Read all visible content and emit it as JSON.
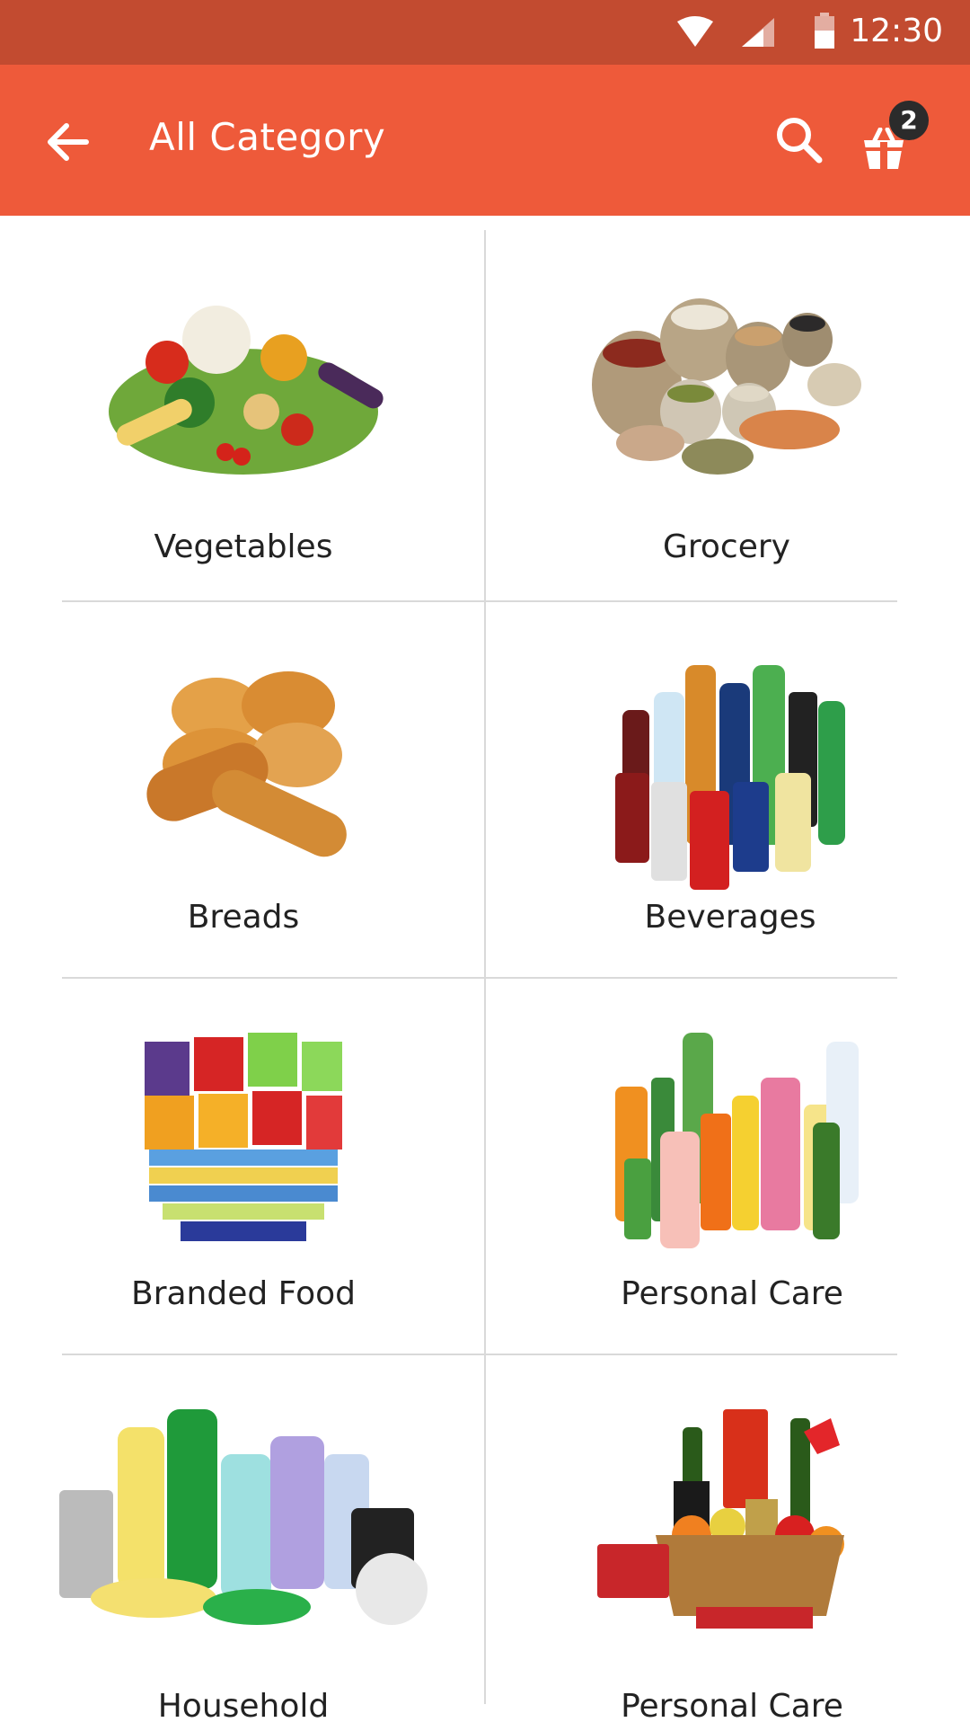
{
  "status_bar": {
    "time": "12:30"
  },
  "app_bar": {
    "title": "All Category",
    "cart_count": "2"
  },
  "categories": [
    {
      "label": "Vegetables"
    },
    {
      "label": "Grocery"
    },
    {
      "label": "Breads"
    },
    {
      "label": "Beverages"
    },
    {
      "label": "Branded Food"
    },
    {
      "label": "Personal Care"
    },
    {
      "label": "Household"
    },
    {
      "label": "Personal Care"
    }
  ],
  "colors": {
    "status_bar": "#c24b30",
    "app_bar": "#ee5a3a",
    "badge": "#2b2b2b"
  },
  "icons": [
    "back-arrow-icon",
    "search-icon",
    "cart-icon",
    "wifi-icon",
    "signal-icon",
    "battery-icon"
  ]
}
